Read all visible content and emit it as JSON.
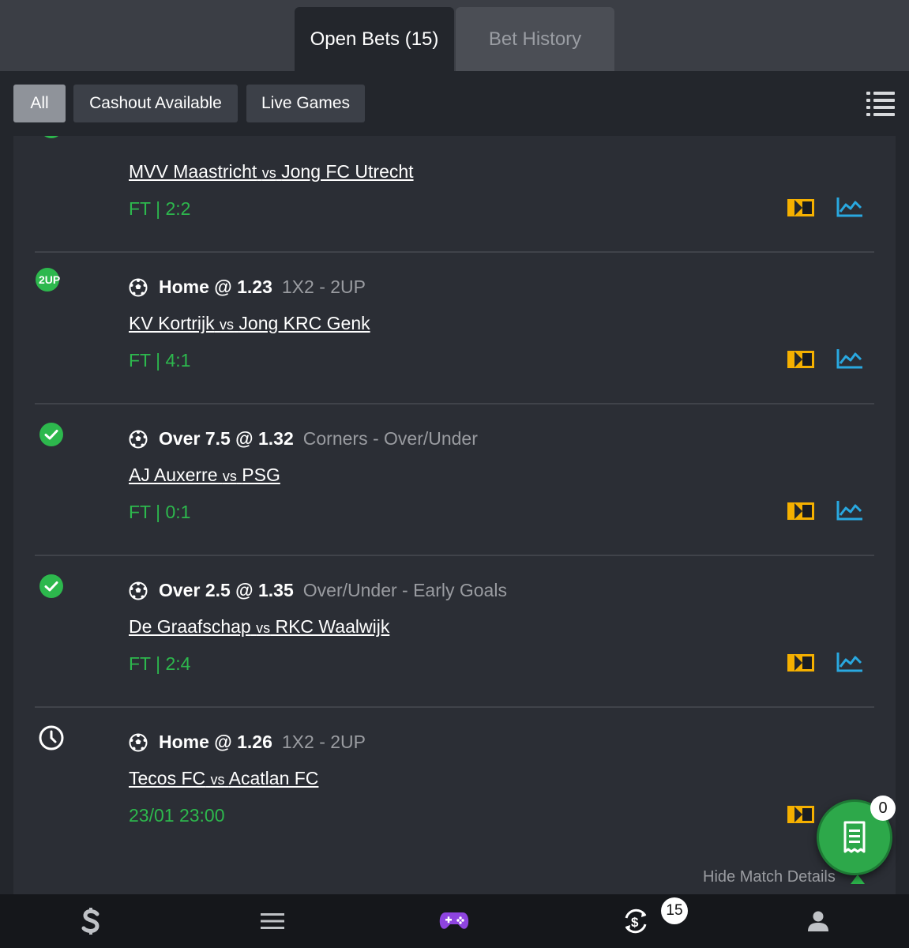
{
  "tabs": {
    "open_bets": "Open Bets (15)",
    "bet_history": "Bet History"
  },
  "filters": {
    "all": "All",
    "cashout": "Cashout Available",
    "live": "Live Games"
  },
  "bets": [
    {
      "status": "check-partial-icon",
      "selection": "",
      "market": "",
      "home": "MVV Maastricht",
      "vs": "vs",
      "away": "Jong FC Utrecht",
      "result": "FT | 2:2"
    },
    {
      "status": "2up-icon",
      "status_label": "2UP",
      "selection": "Home @ 1.23",
      "market": "1X2 - 2UP",
      "home": "KV Kortrijk",
      "vs": "vs",
      "away": "Jong KRC Genk",
      "result": "FT | 4:1"
    },
    {
      "status": "check-icon",
      "selection": "Over 7.5 @ 1.32",
      "market": "Corners - Over/Under",
      "home": "AJ Auxerre",
      "vs": "vs",
      "away": "PSG",
      "result": "FT | 0:1"
    },
    {
      "status": "check-icon",
      "selection": "Over 2.5 @ 1.35",
      "market": "Over/Under - Early Goals",
      "home": "De Graafschap",
      "vs": "vs",
      "away": "RKC Waalwijk",
      "result": "FT | 2:4"
    },
    {
      "status": "clock-icon",
      "selection": "Home @ 1.26",
      "market": "1X2 - 2UP",
      "home": "Tecos FC",
      "vs": "vs",
      "away": "Acatlan FC",
      "result": "23/01 23:00"
    }
  ],
  "hide_details": "Hide Match Details",
  "betslip": {
    "count": "0"
  },
  "nav": {
    "items": [
      "sports-logo-icon",
      "menu-icon",
      "games-controller-icon",
      "my-bets-icon",
      "profile-icon"
    ],
    "my_bets_badge": "15"
  },
  "colors": {
    "background": "#23262c",
    "panel": "#2b2e35",
    "green": "#2db84d",
    "tv_yellow": "#f5b000",
    "stats_blue": "#29a8e0"
  }
}
